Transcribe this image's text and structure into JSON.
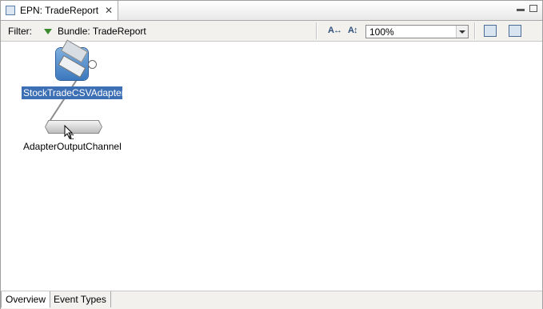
{
  "editor_tab": {
    "title": "EPN: TradeReport",
    "close": "✕"
  },
  "toolbar": {
    "filter_label": "Filter:",
    "bundle_label": "Bundle: TradeReport",
    "zoom_value": "100%"
  },
  "canvas": {
    "adapter_label": "StockTradeCSVAdapter",
    "channel_label": "AdapterOutputChannel"
  },
  "bottom_tabs": [
    "Overview",
    "Event Types"
  ]
}
